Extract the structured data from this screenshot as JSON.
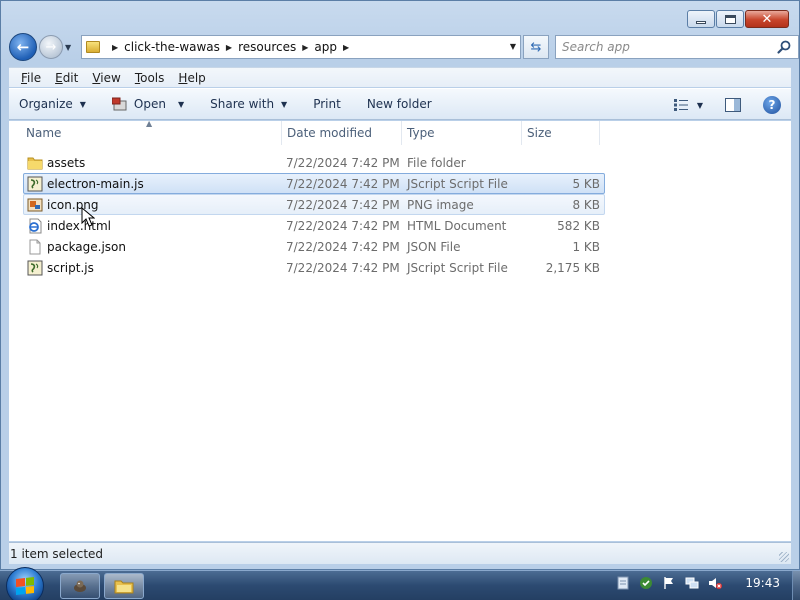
{
  "window": {
    "caption_buttons": {
      "minimize": "minimize",
      "maximize": "maximize",
      "close": "close"
    }
  },
  "address": {
    "crumbs": [
      "click-the-wawas",
      "resources",
      "app"
    ]
  },
  "search": {
    "placeholder": "Search app"
  },
  "menu": [
    {
      "label": "File",
      "accel": "F",
      "rest": "ile"
    },
    {
      "label": "Edit",
      "accel": "E",
      "rest": "dit"
    },
    {
      "label": "View",
      "accel": "V",
      "rest": "iew"
    },
    {
      "label": "Tools",
      "accel": "T",
      "rest": "ools"
    },
    {
      "label": "Help",
      "accel": "H",
      "rest": "elp"
    }
  ],
  "commands": {
    "organize": "Organize",
    "open": "Open",
    "share_with": "Share with",
    "print": "Print",
    "new_folder": "New folder"
  },
  "columns": {
    "name": "Name",
    "date_modified": "Date modified",
    "type": "Type",
    "size": "Size"
  },
  "files": [
    {
      "name": "assets",
      "date": "7/22/2024 7:42 PM",
      "type": "File folder",
      "size": "",
      "icon": "folder-icon",
      "state": ""
    },
    {
      "name": "electron-main.js",
      "date": "7/22/2024 7:42 PM",
      "type": "JScript Script File",
      "size": "5 KB",
      "icon": "js-file-icon",
      "state": "selected"
    },
    {
      "name": "icon.png",
      "date": "7/22/2024 7:42 PM",
      "type": "PNG image",
      "size": "8 KB",
      "icon": "image-file-icon",
      "state": "hover"
    },
    {
      "name": "index.html",
      "date": "7/22/2024 7:42 PM",
      "type": "HTML Document",
      "size": "582 KB",
      "icon": "html-file-icon",
      "state": ""
    },
    {
      "name": "package.json",
      "date": "7/22/2024 7:42 PM",
      "type": "JSON File",
      "size": "1 KB",
      "icon": "json-file-icon",
      "state": ""
    },
    {
      "name": "script.js",
      "date": "7/22/2024 7:42 PM",
      "type": "JScript Script File",
      "size": "2,175 KB",
      "icon": "js-file-icon",
      "state": ""
    }
  ],
  "status": {
    "text": "1 item selected"
  },
  "taskbar": {
    "clock": "19:43"
  }
}
